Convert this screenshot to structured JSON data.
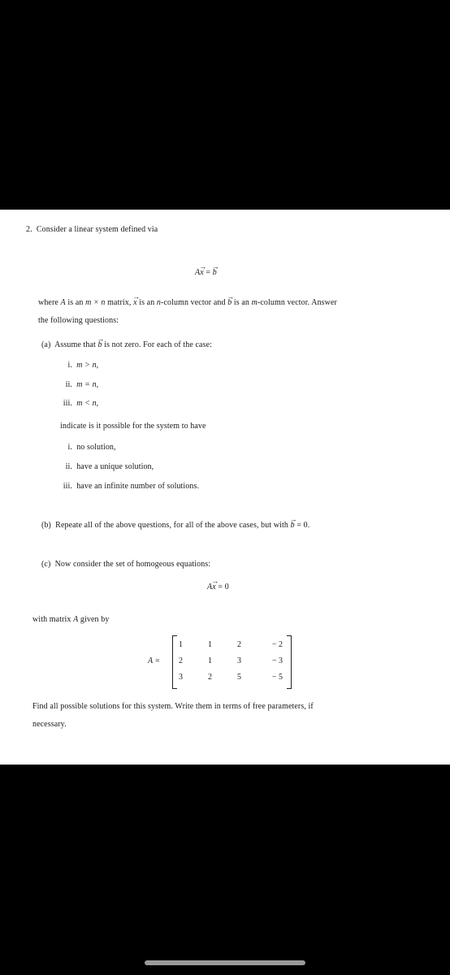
{
  "document": {
    "problem_number": "2.",
    "intro": "Consider a linear system defined via",
    "main_equation": {
      "lhs_matrix": "A",
      "lhs_vector": "x",
      "equals": "=",
      "rhs_vector": "b"
    },
    "where_line": {
      "p1": "where ",
      "A": "A",
      "p2": " is an ",
      "dims": "m × n",
      "p3": " matrix, ",
      "x": "x",
      "p4": " is an ",
      "n": "n",
      "p5": "-column vector and ",
      "b": "b",
      "p6": " is an ",
      "m": "m",
      "p7": "-column vector. Answer"
    },
    "following": "the following questions:",
    "part_a": {
      "label": "(a)",
      "p1": "Assume that ",
      "b": "b",
      "p2": " is not zero. For each of the case:",
      "cases": [
        {
          "num": "i.",
          "expr": "m > n,"
        },
        {
          "num": "ii.",
          "expr": "m = n,"
        },
        {
          "num": "iii.",
          "expr": "m < n,"
        }
      ],
      "indicate": "indicate is it possible for the system to have",
      "outcomes": [
        {
          "num": "i.",
          "text": "no solution,"
        },
        {
          "num": "ii.",
          "text": "have a unique solution,"
        },
        {
          "num": "iii.",
          "text": "have an infinite number of solutions."
        }
      ]
    },
    "part_b": {
      "label": "(b)",
      "p1": "Repeate all of the above questions, for all of the above cases, but with ",
      "b": "b",
      "p2": " = 0."
    },
    "part_c": {
      "label": "(c)",
      "text": "Now consider the set of homogeous equations:",
      "equation": {
        "lhs_matrix": "A",
        "lhs_vector": "x",
        "rhs": "= 0"
      },
      "with_matrix": {
        "p1": "with matrix ",
        "A": "A",
        "p2": " given by"
      },
      "matrix_label": "A =",
      "matrix": [
        [
          "1",
          "1",
          "2",
          "− 2"
        ],
        [
          "2",
          "1",
          "3",
          "− 3"
        ],
        [
          "3",
          "2",
          "5",
          "− 5"
        ]
      ],
      "find": "Find all possible solutions for this system. Write them in terms of free parameters, if",
      "necessary": "necessary."
    }
  }
}
